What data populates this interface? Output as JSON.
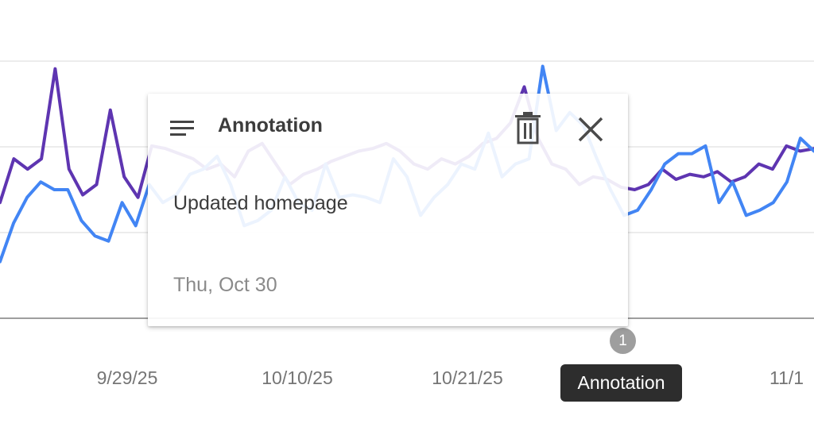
{
  "chart_data": {
    "type": "line",
    "x_ticks": [
      "9/29/25",
      "10/10/25",
      "10/21/25",
      "11/1"
    ],
    "ylim": [
      0,
      100
    ],
    "grid": true,
    "series": [
      {
        "color": "#5e35b1",
        "values": [
          45,
          62,
          58,
          62,
          97,
          58,
          48,
          52,
          81,
          55,
          47,
          67,
          66,
          64,
          62,
          58,
          60,
          55,
          65,
          68,
          60,
          52,
          56,
          58,
          61,
          63,
          65,
          66,
          68,
          65,
          60,
          58,
          62,
          60,
          63,
          68,
          70,
          76,
          90,
          70,
          60,
          58,
          52,
          55,
          54,
          51,
          50,
          52,
          58,
          54,
          56,
          55,
          57,
          53,
          55,
          60,
          58,
          67,
          65,
          66
        ]
      },
      {
        "color": "#4285f4",
        "values": [
          22,
          37,
          47,
          53,
          50,
          50,
          38,
          32,
          30,
          45,
          36,
          52,
          45,
          48,
          56,
          58,
          63,
          52,
          36,
          38,
          42,
          55,
          45,
          42,
          60,
          47,
          48,
          47,
          45,
          62,
          55,
          40,
          47,
          52,
          60,
          58,
          72,
          55,
          60,
          62,
          98,
          73,
          80,
          75,
          62,
          50,
          40,
          42,
          50,
          60,
          64,
          64,
          67,
          45,
          53,
          40,
          42,
          45,
          53,
          70,
          65
        ]
      }
    ],
    "annotation": {
      "title": "Annotation",
      "text": "Updated homepage",
      "date": "Thu, Oct 30",
      "marker_count": "1",
      "tooltip": "Annotation"
    }
  },
  "icons": {
    "menu": "menu-lines-icon",
    "delete": "trash-icon",
    "close": "close-icon"
  }
}
